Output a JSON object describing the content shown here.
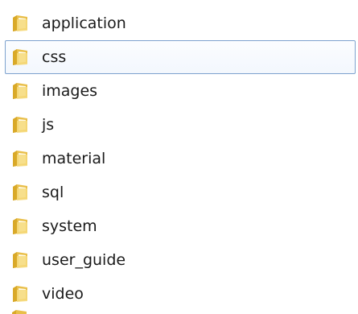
{
  "folders": [
    {
      "name": "application",
      "icon": "folder-icon"
    },
    {
      "name": "css",
      "icon": "folder-icon"
    },
    {
      "name": "images",
      "icon": "folder-icon"
    },
    {
      "name": "js",
      "icon": "folder-icon"
    },
    {
      "name": "material",
      "icon": "folder-icon"
    },
    {
      "name": "sql",
      "icon": "folder-icon"
    },
    {
      "name": "system",
      "icon": "folder-icon"
    },
    {
      "name": "user_guide",
      "icon": "folder-icon"
    },
    {
      "name": "video",
      "icon": "folder-icon"
    }
  ],
  "focused_item": "css",
  "colors": {
    "focus_border": "#7da2ce",
    "folder_back": "#d9a928",
    "folder_front": "#f6d97a",
    "folder_page": "#fffbe9"
  }
}
